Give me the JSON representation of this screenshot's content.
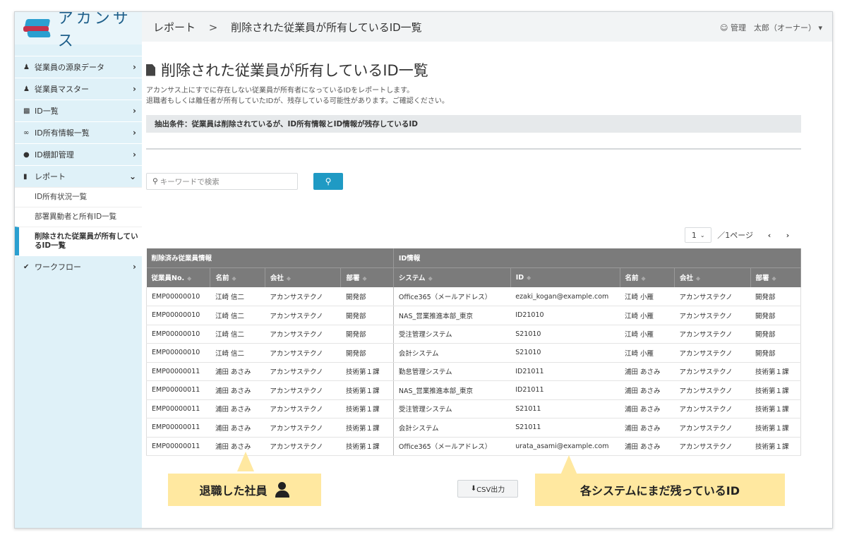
{
  "app": {
    "name": "アカンサス"
  },
  "breadcrumb": {
    "parent": "レポート",
    "separator": ">",
    "current": "削除された従業員が所有しているID一覧"
  },
  "user": {
    "label": "管理　太郎（オーナー）"
  },
  "sidebar": {
    "items": [
      {
        "label": "従業員の源泉データ",
        "icon": "person-icon"
      },
      {
        "label": "従業員マスター",
        "icon": "users-icon"
      },
      {
        "label": "ID一覧",
        "icon": "id-card-icon"
      },
      {
        "label": "ID所有情報一覧",
        "icon": "link-icon"
      },
      {
        "label": "ID棚卸管理",
        "icon": "chat-icon"
      },
      {
        "label": "レポート",
        "icon": "document-icon"
      },
      {
        "label": "ワークフロー",
        "icon": "check-icon"
      }
    ],
    "report_sub": [
      {
        "label": "ID所有状況一覧"
      },
      {
        "label": "部署異動者と所有ID一覧"
      },
      {
        "label": "削除された従業員が所有しているID一覧"
      }
    ]
  },
  "page": {
    "title": "削除された従業員が所有しているID一覧",
    "desc1": "アカンサス上にすでに存在しない従業員が所有者になっているIDをレポートします。",
    "desc2": "退職者もしくは離任者が所有していたIDが、残存している可能性があります。ご確認ください。",
    "condition": "抽出条件：従業員は削除されているが、ID所有情報とID情報が残存しているID"
  },
  "search": {
    "placeholder": "キーワードで検索"
  },
  "pager": {
    "page": "1",
    "total": "／1ページ"
  },
  "table": {
    "group_deleted": "削除済み従業員情報",
    "group_id": "ID情報",
    "headers": [
      "従業員No.",
      "名前",
      "会社",
      "部署",
      "システム",
      "ID",
      "名前",
      "会社",
      "部署"
    ],
    "rows": [
      [
        "EMP00000010",
        "江崎 信二",
        "アカンサステクノ",
        "開発部",
        "Office365（メールアドレス）",
        "ezaki_kogan@example.com",
        "江崎 小雁",
        "アカンサステクノ",
        "開発部"
      ],
      [
        "EMP00000010",
        "江崎 信二",
        "アカンサステクノ",
        "開発部",
        "NAS_営業推進本部_東京",
        "ID21010",
        "江崎 小雁",
        "アカンサステクノ",
        "開発部"
      ],
      [
        "EMP00000010",
        "江崎 信二",
        "アカンサステクノ",
        "開発部",
        "受注管理システム",
        "S21010",
        "江崎 小雁",
        "アカンサステクノ",
        "開発部"
      ],
      [
        "EMP00000010",
        "江崎 信二",
        "アカンサステクノ",
        "開発部",
        "会計システム",
        "S21010",
        "江崎 小雁",
        "アカンサステクノ",
        "開発部"
      ],
      [
        "EMP00000011",
        "浦田 あさみ",
        "アカンサステクノ",
        "技術第１課",
        "勤怠管理システム",
        "ID21011",
        "浦田 あさみ",
        "アカンサステクノ",
        "技術第１課"
      ],
      [
        "EMP00000011",
        "浦田 あさみ",
        "アカンサステクノ",
        "技術第１課",
        "NAS_営業推進本部_東京",
        "ID21011",
        "浦田 あさみ",
        "アカンサステクノ",
        "技術第１課"
      ],
      [
        "EMP00000011",
        "浦田 あさみ",
        "アカンサステクノ",
        "技術第１課",
        "受注管理システム",
        "S21011",
        "浦田 あさみ",
        "アカンサステクノ",
        "技術第１課"
      ],
      [
        "EMP00000011",
        "浦田 あさみ",
        "アカンサステクノ",
        "技術第１課",
        "会計システム",
        "S21011",
        "浦田 あさみ",
        "アカンサステクノ",
        "技術第１課"
      ],
      [
        "EMP00000011",
        "浦田 あさみ",
        "アカンサステクノ",
        "技術第１課",
        "Office365（メールアドレス）",
        "urata_asami@example.com",
        "浦田 あさみ",
        "アカンサステクノ",
        "技術第１課"
      ]
    ]
  },
  "csv_button": "CSV出力",
  "callouts": {
    "retired": "退職した社員",
    "remaining": "各システムにまだ残っているID"
  },
  "colors": {
    "accent": "#1f9ac4",
    "sidebar": "#dff1f8",
    "table_header": "#7b7b7b",
    "callout": "#ffe8a0",
    "brand_red": "#c4314b"
  }
}
